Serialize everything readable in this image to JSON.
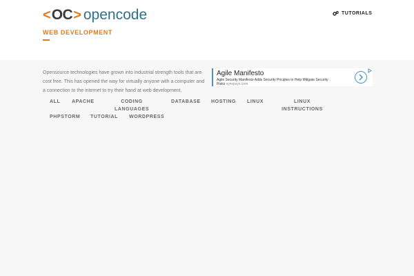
{
  "header": {
    "logo": {
      "bracket_left": "<",
      "mark": "OC",
      "bracket_right": ">",
      "word": "opencode"
    },
    "nav": {
      "tutorials_label": "TUTORIALS"
    }
  },
  "page": {
    "title": "WEB DEVELOPMENT",
    "intro": "Opensource technologies have grown into industrial strength tools that are cost free.  This has opened the way for virtually anyone with a computer and a connection to the internet to try their hand at web development."
  },
  "ad": {
    "title": "Agile Manifesto",
    "text": "Agile Security Manifesto Adds Security Priciples to Help Mitigate Security Risks",
    "url": "synopsys.com"
  },
  "filters": [
    {
      "label": "ALL"
    },
    {
      "label": "APACHE"
    },
    {
      "label": "CODING LANGUAGES"
    },
    {
      "label": "DATABASE"
    },
    {
      "label": "HOSTING"
    },
    {
      "label": "LINUX"
    },
    {
      "label": "LINUX INSTRUCTIONS"
    },
    {
      "label": "PHPSTORM"
    },
    {
      "label": "TUTORIAL"
    },
    {
      "label": "WORDPRESS"
    }
  ],
  "colors": {
    "accent": "#e07b1c",
    "brand": "#2e6f8a",
    "ad_accent": "#4a90c8"
  },
  "icons": {
    "nav": "cogs-icon",
    "ad": "chevron-right-icon",
    "ad_choices": "ad-choices-icon"
  }
}
